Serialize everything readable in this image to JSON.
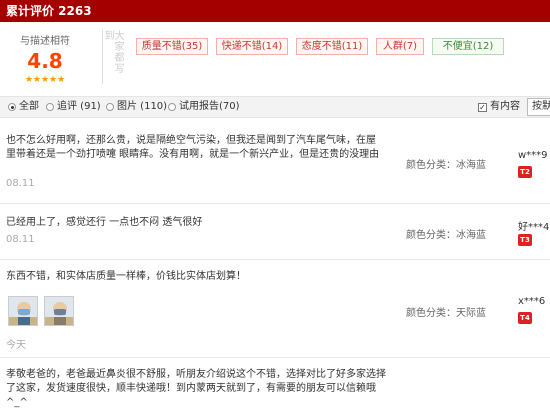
{
  "header": {
    "title": "累计评价 2263"
  },
  "summary": {
    "score_label": "与描述相符",
    "score": "4.8",
    "stars": "★★★★★",
    "big_label": "大家都写到",
    "tags": [
      {
        "label": "质量不错(35)",
        "sentiment": "positive-red"
      },
      {
        "label": "快递不错(14)",
        "sentiment": "positive-red"
      },
      {
        "label": "态度不错(11)",
        "sentiment": "positive-red"
      },
      {
        "label": "人群(7)",
        "sentiment": "positive-red"
      },
      {
        "label": "不便宜(12)",
        "sentiment": "negative-green"
      }
    ]
  },
  "filters": {
    "all": "全部",
    "followup": "追评 (91)",
    "images": "图片 (110)",
    "trial": "试用报告(70)",
    "has_content": "有内容",
    "sort": "按默"
  },
  "reviews": [
    {
      "content": "也不怎么好用啊，还那么贵，说是隔绝空气污染，但我还是闻到了汽车尾气味，在屋里带着还是一个劲打喷嚏 眼睛痒。没有用啊，就是一个新兴产业，但是还贵的没理由",
      "date": "08.11",
      "sku": "颜色分类：冰海蓝",
      "user": "w***9",
      "badge": "T2"
    },
    {
      "content": "已经用上了，感觉还行 一点也不闷 透气很好",
      "date": "08.11",
      "sku": "颜色分类：冰海蓝",
      "user": "好***4",
      "badge": "T3"
    },
    {
      "content": "东西不错，和实体店质量一样棒，价钱比实体店划算！",
      "date": "今天",
      "sku": "颜色分类：天际蓝",
      "user": "x***6",
      "badge": "T4"
    },
    {
      "content": "孝敬老爸的，老爸最近鼻炎很不舒服，听朋友介绍说这个不错，选择对比了好多家选择了这家，发货速度很快，顺丰快递哦！到内蒙两天就到了，有需要的朋友可以信赖哦^_^",
      "date": "",
      "sku": "",
      "user": "",
      "badge": ""
    }
  ]
}
